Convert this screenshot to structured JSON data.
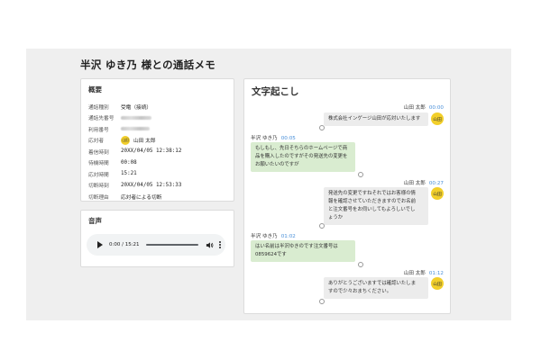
{
  "page_title": "半沢 ゆき乃 様との通話メモ",
  "summary": {
    "heading": "概要",
    "rows": [
      {
        "label": "通話種別",
        "value": "受電（接続）"
      },
      {
        "label": "通話先番号",
        "value": ""
      },
      {
        "label": "利用番号",
        "value": ""
      },
      {
        "label": "応対者",
        "value": "山田 太郎",
        "avatar": "山田"
      },
      {
        "label": "着信時刻",
        "value": "20XX/04/05 12:38:12"
      },
      {
        "label": "待機時間",
        "value": "00:08"
      },
      {
        "label": "応対時間",
        "value": "15:21"
      },
      {
        "label": "切断時刻",
        "value": "20XX/04/05 12:53:33"
      },
      {
        "label": "切断理由",
        "value": "応対者による切断"
      }
    ]
  },
  "audio": {
    "heading": "音声",
    "time": "0:00 / 15:21",
    "progress": 0
  },
  "transcript": {
    "heading": "文字起こし",
    "messages": [
      {
        "speaker": "山田 太郎",
        "time": "00:00",
        "role": "operator",
        "avatar": "山田",
        "lines": [
          "株式会社インゲージ山田が応対いたします"
        ]
      },
      {
        "speaker": "半沢 ゆき乃",
        "time": "00:05",
        "role": "customer",
        "lines": [
          "もしもし、先日そちらのホームページで商",
          "品を購入したのですがその発送先の変更を",
          "お願いたいのですが"
        ]
      },
      {
        "speaker": "山田 太郎",
        "time": "00:27",
        "role": "operator",
        "avatar": "山田",
        "lines": [
          "発送先の変更ですねそれではお客様の情",
          "報を確認させていただきますのでお名前",
          "と注文番号をお伺いしてもよろしいでし",
          "ょうか"
        ]
      },
      {
        "speaker": "半沢 ゆき乃",
        "time": "01:02",
        "role": "customer",
        "lines": [
          "はい名前は半沢ゆきのです注文番号は",
          "0859624です"
        ]
      },
      {
        "speaker": "山田 太郎",
        "time": "01:12",
        "role": "operator",
        "avatar": "山田",
        "lines": [
          "ありがとうございますでは確認いたしま",
          "すので少々おまちください。"
        ]
      }
    ]
  },
  "colors": {
    "avatar": "#f2cf2a",
    "timestamp": "#4a90d9",
    "operator_bubble": "#ececec",
    "customer_bubble": "#d9ecd0",
    "background": "#efefef"
  }
}
